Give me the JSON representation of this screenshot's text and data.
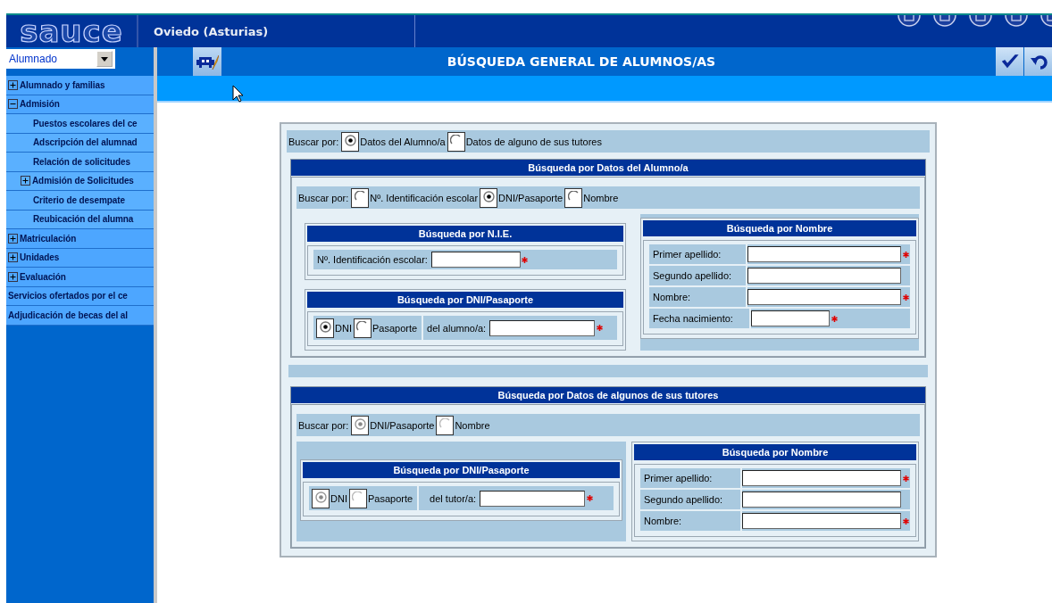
{
  "header": {
    "logo": "sauce",
    "location": "Oviedo (Asturias)"
  },
  "sidebar": {
    "module_select": {
      "value": "Alumnado"
    },
    "items": [
      {
        "kind": "group",
        "label": "Alumnado y familias",
        "expanded": false
      },
      {
        "kind": "group",
        "label": "Admisión",
        "expanded": true,
        "children": [
          {
            "kind": "link",
            "label": "Puestos escolares del ce"
          },
          {
            "kind": "link",
            "label": "Adscripción del alumnad"
          },
          {
            "kind": "link",
            "label": "Relación de solicitudes"
          },
          {
            "kind": "group",
            "label": "Admisión de Solicitudes",
            "expanded": false
          },
          {
            "kind": "link",
            "label": "Criterio de desempate"
          },
          {
            "kind": "link",
            "label": "Reubicación del alumna"
          }
        ]
      },
      {
        "kind": "group",
        "label": "Matriculación",
        "expanded": false
      },
      {
        "kind": "group",
        "label": "Unidades",
        "expanded": false
      },
      {
        "kind": "group",
        "label": "Evaluación",
        "expanded": false
      },
      {
        "kind": "link",
        "label": "Servicios ofertados por el ce"
      },
      {
        "kind": "link",
        "label": "Adjudicación de becas del al"
      }
    ]
  },
  "toolbar": {
    "title": "BÚSQUEDA GENERAL DE ALUMNOS/AS"
  },
  "form": {
    "search_by": {
      "label": "Buscar por:",
      "disabled": false,
      "options": [
        {
          "label": "Datos del Alumno/a",
          "selected": true
        },
        {
          "label": "Datos de alguno de sus tutores",
          "selected": false
        }
      ]
    },
    "student": {
      "title": "Búsqueda por Datos del Alumno/a",
      "search_by": {
        "label": "Buscar por:",
        "disabled": false,
        "options": [
          {
            "label": "Nº. Identificación escolar",
            "selected": false
          },
          {
            "label": "DNI/Pasaporte",
            "selected": true
          },
          {
            "label": "Nombre",
            "selected": false
          }
        ]
      },
      "nie": {
        "title": "Búsqueda por N.I.E.",
        "fields": [
          {
            "label": "Nº. Identificación escolar:",
            "required": true
          }
        ]
      },
      "dni": {
        "title": "Búsqueda por DNI/Pasaporte",
        "doc_type": {
          "disabled": false,
          "options": [
            {
              "label": "DNI",
              "selected": true
            },
            {
              "label": "Pasaporte",
              "selected": false
            }
          ]
        },
        "field": {
          "label": "del alumno/a:",
          "required": true
        }
      },
      "name": {
        "title": "Búsqueda por Nombre",
        "fields": [
          {
            "kind": "text",
            "label": "Primer apellido:",
            "required": true
          },
          {
            "kind": "text",
            "label": "Segundo apellido:",
            "required": false
          },
          {
            "kind": "text",
            "label": "Nombre:",
            "required": true
          },
          {
            "kind": "date",
            "label": "Fecha nacimiento:",
            "required": true
          }
        ]
      }
    },
    "tutor": {
      "title": "Búsqueda por Datos de algunos de sus tutores",
      "search_by": {
        "label": "Buscar por:",
        "disabled": true,
        "options": [
          {
            "label": "DNI/Pasaporte",
            "selected": true
          },
          {
            "label": "Nombre",
            "selected": false
          }
        ]
      },
      "dni": {
        "title": "Búsqueda por DNI/Pasaporte",
        "doc_type": {
          "disabled": true,
          "options": [
            {
              "label": "DNI",
              "selected": true
            },
            {
              "label": "Pasaporte",
              "selected": false
            }
          ]
        },
        "field": {
          "label": "del tutor/a:",
          "required": true
        }
      },
      "name": {
        "title": "Búsqueda por Nombre",
        "fields": [
          {
            "kind": "text",
            "label": "Primer apellido:",
            "required": true
          },
          {
            "kind": "text",
            "label": "Segundo apellido:",
            "required": false
          },
          {
            "kind": "text",
            "label": "Nombre:",
            "required": true
          }
        ]
      }
    }
  }
}
